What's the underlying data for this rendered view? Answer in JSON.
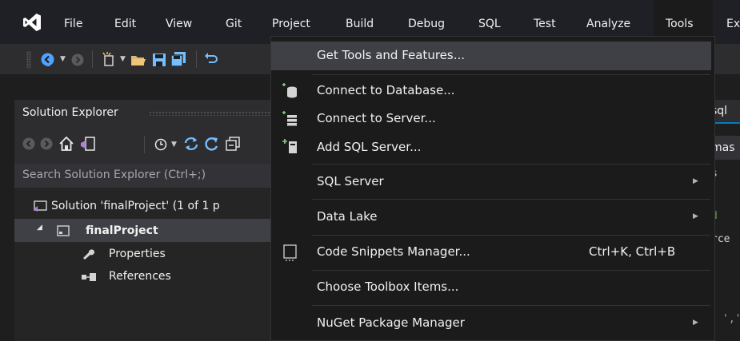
{
  "menubar": {
    "items": [
      "File",
      "Edit",
      "View",
      "Git",
      "Project",
      "Build",
      "Debug",
      "SQL",
      "Test",
      "Analyze",
      "Tools",
      "Ex"
    ],
    "active": "Tools"
  },
  "toolbar": {
    "icons": [
      "back-icon",
      "dropdown-arrow-icon",
      "forward-icon",
      "new-item-icon",
      "open-folder-icon",
      "save-icon",
      "save-all-icon"
    ]
  },
  "solution_explorer": {
    "title": "Solution Explorer",
    "search_placeholder": "Search Solution Explorer (Ctrl+;)",
    "tree": {
      "solution": "Solution 'finalProject' (1 of 1 p",
      "project": "finalProject",
      "properties": "Properties",
      "references": "References"
    }
  },
  "editor": {
    "tab_label": "sql",
    "second_line": "mas",
    "code_lines": [
      "s",
      "d",
      "rce"
    ],
    "trailing": "','"
  },
  "tools_menu": {
    "items": [
      {
        "label": "Get Tools and Features...",
        "icon": null,
        "shortcut": "",
        "submenu": false,
        "highlighted": true
      },
      {
        "label": "Connect to Database...",
        "icon": "database-icon",
        "shortcut": "",
        "submenu": false
      },
      {
        "label": "Connect to Server...",
        "icon": "server-icon",
        "shortcut": "",
        "submenu": false
      },
      {
        "label": "Add SQL Server...",
        "icon": "add-sql-server-icon",
        "shortcut": "",
        "submenu": false
      },
      {
        "label": "SQL Server",
        "icon": null,
        "shortcut": "",
        "submenu": true
      },
      {
        "label": "Data Lake",
        "icon": null,
        "shortcut": "",
        "submenu": true
      },
      {
        "label": "Code Snippets Manager...",
        "icon": "snippet-icon",
        "shortcut": "Ctrl+K, Ctrl+B",
        "submenu": false
      },
      {
        "label": "Choose Toolbox Items...",
        "icon": null,
        "shortcut": "",
        "submenu": false
      },
      {
        "label": "NuGet Package Manager",
        "icon": null,
        "shortcut": "",
        "submenu": true
      }
    ]
  },
  "colors": {
    "accent": "#007acc",
    "menu_bg": "#1b1b1c",
    "hover_bg": "#3f3f46",
    "vs_purple": "#ffffff"
  }
}
